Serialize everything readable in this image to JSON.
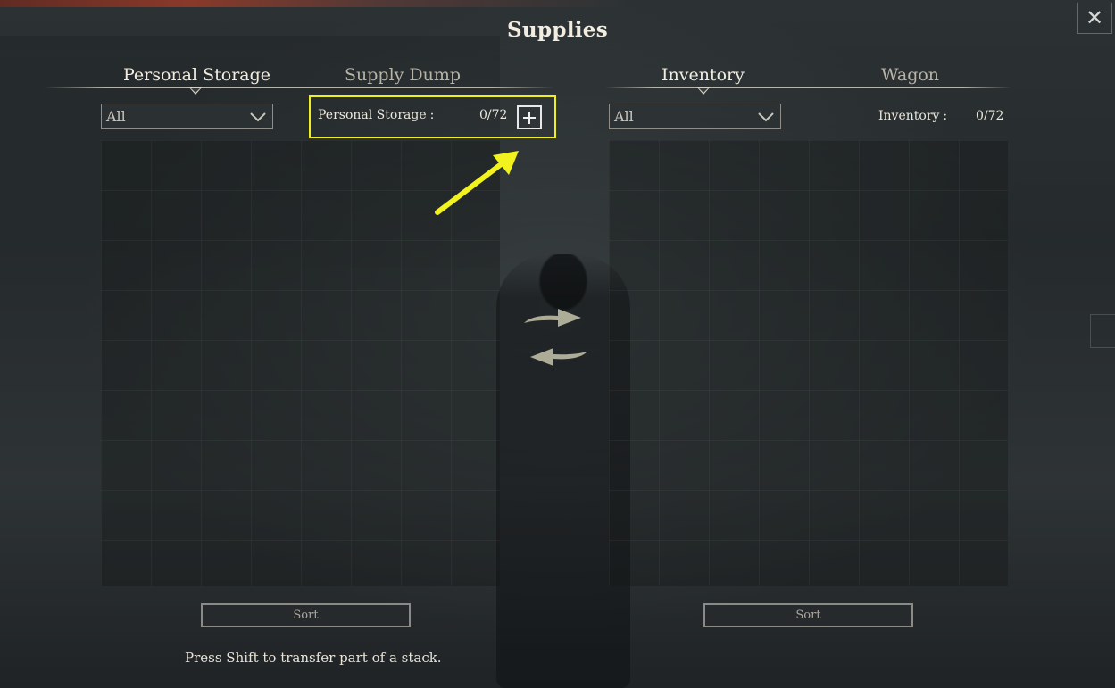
{
  "window": {
    "title": "Supplies",
    "close_icon": "close-icon"
  },
  "left": {
    "tabs": [
      {
        "label": "Personal Storage",
        "active": true
      },
      {
        "label": "Supply Dump",
        "active": false
      }
    ],
    "filter": {
      "selected": "All",
      "icon": "chevron-down-icon"
    },
    "counter": {
      "label": "Personal Storage",
      "sep": ":",
      "value": "0/72",
      "add_icon": "plus-icon"
    },
    "sort_label": "Sort"
  },
  "right": {
    "tabs": [
      {
        "label": "Inventory",
        "active": true
      },
      {
        "label": "Wagon",
        "active": false
      }
    ],
    "filter": {
      "selected": "All",
      "icon": "chevron-down-icon"
    },
    "counter": {
      "label": "Inventory",
      "sep": ":",
      "value": "0/72"
    },
    "sort_label": "Sort"
  },
  "transfer": {
    "to_right_icon": "arrow-right-icon",
    "to_left_icon": "arrow-left-icon"
  },
  "hint": "Press Shift to transfer part of a stack.",
  "annotation": {
    "color": "#eeee22",
    "icon": "pointer-arrow-icon"
  }
}
